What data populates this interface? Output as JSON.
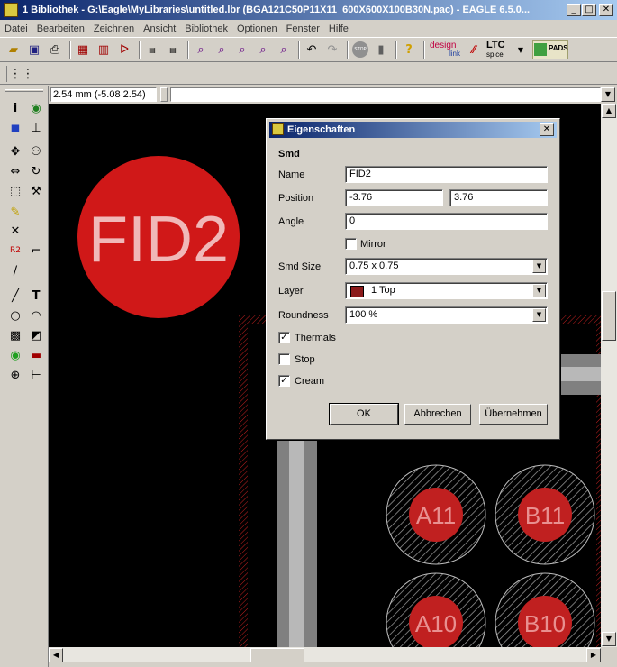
{
  "window": {
    "title": "1 Bibliothek - G:\\Eagle\\MyLibraries\\untitled.lbr (BGA121C50P11X11_600X600X100B30N.pac) - EAGLE 6.5.0...",
    "minimize": "_",
    "maximize": "□",
    "close": "✕"
  },
  "menu": [
    "Datei",
    "Bearbeiten",
    "Zeichnen",
    "Ansicht",
    "Bibliothek",
    "Optionen",
    "Fenster",
    "Hilfe"
  ],
  "toolbar": {
    "brand_design": "design",
    "brand_link": "link",
    "brand_ltc": "LTC",
    "brand_spice": "spice",
    "brand_pads": "PADS",
    "stop_label": "STOP"
  },
  "status": {
    "coordinate": "2.54 mm (-5.08 2.54)"
  },
  "canvas": {
    "fid_label": "FID2",
    "pads": [
      "A11",
      "B11",
      "A10",
      "B10"
    ]
  },
  "dialog": {
    "title": "Eigenschaften",
    "section": "Smd",
    "name_label": "Name",
    "name_value": "FID2",
    "position_label": "Position",
    "position_x": "-3.76",
    "position_y": "3.76",
    "angle_label": "Angle",
    "angle_value": "0",
    "mirror_label": "Mirror",
    "smdsize_label": "Smd Size",
    "smdsize_value": "0.75 x 0.75",
    "layer_label": "Layer",
    "layer_value": "1 Top",
    "layer_color": "#8b1a1a",
    "roundness_label": "Roundness",
    "roundness_value": "100 %",
    "thermals_label": "Thermals",
    "stop_label": "Stop",
    "cream_label": "Cream",
    "ok_label": "OK",
    "cancel_label": "Abbrechen",
    "apply_label": "Übernehmen",
    "checked_mark": "✓"
  },
  "colors": {
    "pad_red": "#d01818",
    "canvas_bg": "#000000",
    "titlebar": "#0a246a"
  }
}
